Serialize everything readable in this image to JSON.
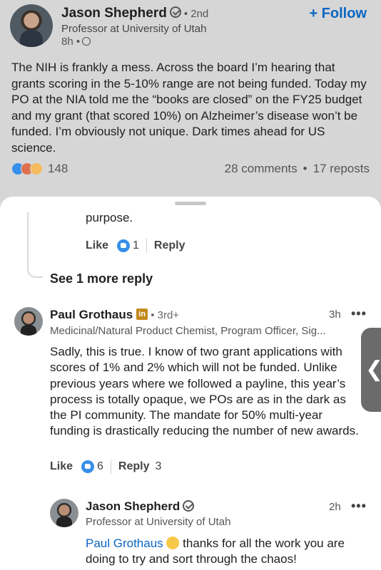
{
  "post": {
    "author": "Jason Shepherd",
    "degree": "• 2nd",
    "headline": "Professor at University of Utah",
    "time": "8h •",
    "follow_label": "+ Follow",
    "text": "The NIH is frankly a mess. Across the board I’m hearing that grants scoring in the 5-10% range are not being funded. Today my PO at the NIA told me the “books are closed” on the FY25 budget and my grant (that scored 10%) on Alzheimer’s disease won’t be funded. I’m obviously not unique. Dark times ahead for US science.",
    "reactions": "148",
    "comments": "28 comments",
    "dot": "•",
    "reposts": "17 reposts"
  },
  "previous_reply": {
    "text": "purpose.",
    "like_label": "Like",
    "like_count": "1",
    "reply_label": "Reply"
  },
  "see_more": "See 1 more reply",
  "comment": {
    "author": "Paul Grothaus",
    "badge": "in",
    "degree": "• 3rd+",
    "headline": "Medicinal/Natural Product Chemist, Program Officer, Sig...",
    "time": "3h",
    "more": "•••",
    "text": "Sadly, this is true. I know of two grant applications with scores of 1% and 2% which will not be funded. Unlike previous years where we followed a payline, this year’s process is totally opaque, we POs are as in the dark as the PI community. The mandate for 50% multi-year funding is drastically reducing the number of new awards.",
    "like_label": "Like",
    "like_count": "6",
    "reply_label": "Reply",
    "reply_count": "3"
  },
  "reply": {
    "author": "Jason Shepherd",
    "headline": "Professor at University of Utah",
    "time": "2h",
    "more": "•••",
    "mention": "Paul Grothaus",
    "text": " thanks for all the work you are doing to try and sort through the chaos!"
  },
  "side_tab": "❮"
}
